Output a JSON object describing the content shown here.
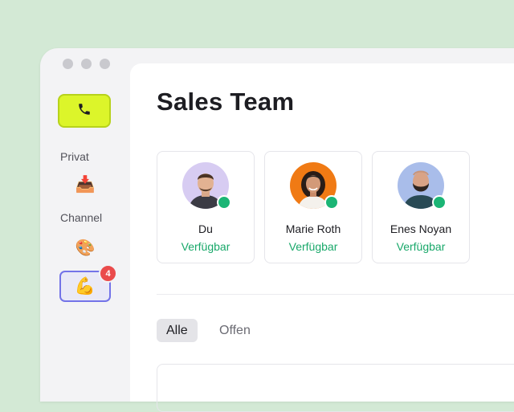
{
  "sidebar": {
    "call_icon": "phone-icon",
    "sections": [
      {
        "label": "Privat",
        "items": [
          {
            "icon": "inbox-tray-icon",
            "emoji": "📥"
          }
        ]
      },
      {
        "label": "Channel",
        "items": [
          {
            "icon": "artist-palette-icon",
            "emoji": "🎨"
          },
          {
            "icon": "flexed-biceps-icon",
            "emoji": "💪",
            "badge": "4"
          }
        ]
      }
    ]
  },
  "main": {
    "title": "Sales Team",
    "members": [
      {
        "name": "Du",
        "status": "Verfügbar"
      },
      {
        "name": "Marie Roth",
        "status": "Verfügbar"
      },
      {
        "name": "Enes Noyan",
        "status": "Verfügbar"
      }
    ],
    "filters": [
      {
        "label": "Alle",
        "active": true
      },
      {
        "label": "Offen",
        "active": false
      }
    ]
  },
  "colors": {
    "background": "#d3e9d5",
    "call_button": "#dcf52a",
    "status_green": "#19a86a",
    "badge_red": "#ea4b4b",
    "selection_border": "#7373e8"
  }
}
